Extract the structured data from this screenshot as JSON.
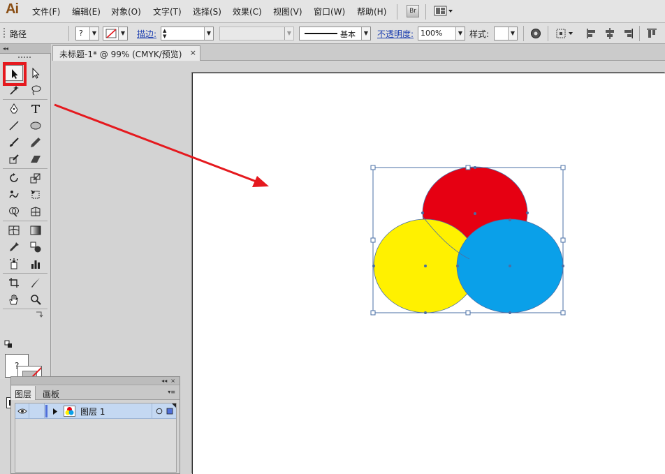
{
  "app": {
    "logo": "Ai"
  },
  "menu": {
    "items": [
      "文件(F)",
      "编辑(E)",
      "对象(O)",
      "文字(T)",
      "选择(S)",
      "效果(C)",
      "视图(V)",
      "窗口(W)",
      "帮助(H)"
    ],
    "bridge_label": "Br"
  },
  "control": {
    "object_type": "路径",
    "fill_value": "?",
    "stroke_label": "描边:",
    "stroke_profile": "基本",
    "opacity_label": "不透明度:",
    "opacity_value": "100%",
    "style_label": "样式:"
  },
  "document": {
    "tab_title": "未标题-1* @ 99% (CMYK/预览)",
    "close_glyph": "×"
  },
  "tools": {
    "panel_collapse": "◂◂",
    "fill_glyph": "?"
  },
  "layers": {
    "collapse": "◂◂",
    "close": "×",
    "tabs": [
      "图层",
      "画板"
    ],
    "menu_glyph": "▾≡",
    "row_name": "图层 1"
  },
  "art": {
    "colors": {
      "red": "#e60012",
      "yellow": "#fff100",
      "blue": "#0aa0e9",
      "selection": "#4a6fa5",
      "annotation": "#e5191e"
    }
  }
}
